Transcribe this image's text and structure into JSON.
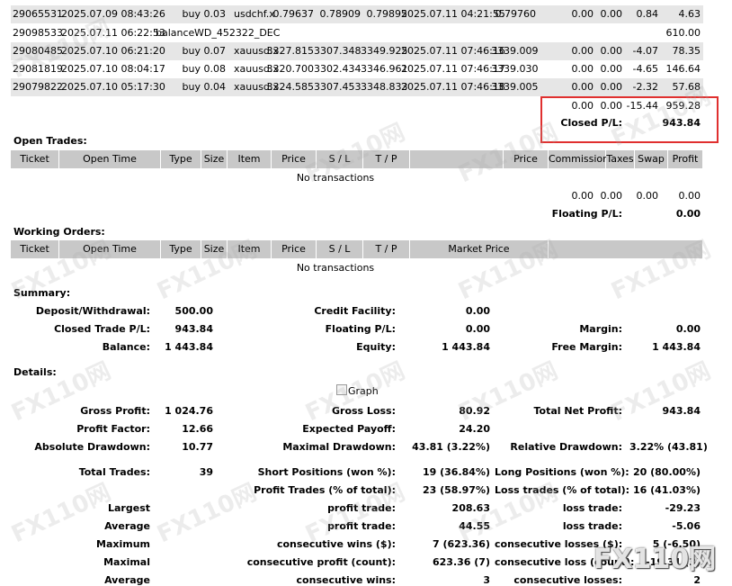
{
  "closed_trades": [
    {
      "ticket": "29065531",
      "open_time": "2025.07.09 08:43:26",
      "type": "buy",
      "size": "0.03",
      "item": "usdchf.x",
      "price": "0.79637",
      "sl": "0.78909",
      "tp": "0.79895",
      "close_time": "2025.07.11 04:21:55",
      "close_price": "0.79760",
      "commission": "0.00",
      "taxes": "0.00",
      "swap": "0.84",
      "profit": "4.63"
    },
    {
      "ticket": "29098533",
      "open_time": "2025.07.11 06:22:53",
      "type": "balance",
      "size": "",
      "item": "WD_452322_DEC",
      "price": "",
      "sl": "",
      "tp": "",
      "close_time": "",
      "close_price": "",
      "commission": "",
      "taxes": "",
      "swap": "",
      "profit": "610.00"
    },
    {
      "ticket": "29080485",
      "open_time": "2025.07.10 06:21:20",
      "type": "buy",
      "size": "0.07",
      "item": "xauusd.x",
      "price": "3327.815",
      "sl": "3307.348",
      "tp": "3349.925",
      "close_time": "2025.07.11 07:46:16",
      "close_price": "3339.009",
      "commission": "0.00",
      "taxes": "0.00",
      "swap": "-4.07",
      "profit": "78.35"
    },
    {
      "ticket": "29081819",
      "open_time": "2025.07.10 08:04:17",
      "type": "buy",
      "size": "0.08",
      "item": "xauusd.x",
      "price": "3320.700",
      "sl": "3302.434",
      "tp": "3346.961",
      "close_time": "2025.07.11 07:46:17",
      "close_price": "3339.030",
      "commission": "0.00",
      "taxes": "0.00",
      "swap": "-4.65",
      "profit": "146.64"
    },
    {
      "ticket": "29079822",
      "open_time": "2025.07.10 05:17:30",
      "type": "buy",
      "size": "0.04",
      "item": "xauusd.x",
      "price": "3324.585",
      "sl": "3307.453",
      "tp": "3348.833",
      "close_time": "2025.07.11 07:46:18",
      "close_price": "3339.005",
      "commission": "0.00",
      "taxes": "0.00",
      "swap": "-2.32",
      "profit": "57.68"
    }
  ],
  "closed_totals": {
    "commission": "0.00",
    "taxes": "0.00",
    "swap": "-15.44",
    "profit": "959.28",
    "pl_label": "Closed P/L:",
    "pl_value": "943.84"
  },
  "open_trades": {
    "title": "Open Trades:",
    "headers": {
      "ticket": "Ticket",
      "open_time": "Open Time",
      "type": "Type",
      "size": "Size",
      "item": "Item",
      "price": "Price",
      "sl": "S / L",
      "tp": "T / P",
      "price2": "Price",
      "commission": "Commission",
      "taxes": "Taxes",
      "swap": "Swap",
      "profit": "Profit"
    },
    "empty": "No transactions",
    "totals": {
      "commission": "0.00",
      "taxes": "0.00",
      "swap": "0.00",
      "profit": "0.00"
    },
    "pl_label": "Floating P/L:",
    "pl_value": "0.00"
  },
  "working_orders": {
    "title": "Working Orders:",
    "headers": {
      "ticket": "Ticket",
      "open_time": "Open Time",
      "type": "Type",
      "size": "Size",
      "item": "Item",
      "price": "Price",
      "sl": "S / L",
      "tp": "T / P",
      "market_price": "Market Price"
    },
    "empty": "No transactions"
  },
  "summary": {
    "title": "Summary:",
    "deposit_label": "Deposit/Withdrawal:",
    "deposit_value": "500.00",
    "credit_label": "Credit Facility:",
    "credit_value": "0.00",
    "closed_pl_label": "Closed Trade P/L:",
    "closed_pl_value": "943.84",
    "floating_label": "Floating P/L:",
    "floating_value": "0.00",
    "margin_label": "Margin:",
    "margin_value": "0.00",
    "balance_label": "Balance:",
    "balance_value": "1 443.84",
    "equity_label": "Equity:",
    "equity_value": "1 443.84",
    "free_margin_label": "Free Margin:",
    "free_margin_value": "1 443.84"
  },
  "details": {
    "title": "Details:",
    "graph_alt": "Graph",
    "gross_profit_label": "Gross Profit:",
    "gross_profit": "1 024.76",
    "gross_loss_label": "Gross Loss:",
    "gross_loss": "80.92",
    "net_profit_label": "Total Net Profit:",
    "net_profit": "943.84",
    "profit_factor_label": "Profit Factor:",
    "profit_factor": "12.66",
    "expected_payoff_label": "Expected Payoff:",
    "expected_payoff": "24.20",
    "abs_dd_label": "Absolute Drawdown:",
    "abs_dd": "10.77",
    "max_dd_label": "Maximal Drawdown:",
    "max_dd": "43.81 (3.22%)",
    "rel_dd_label": "Relative Drawdown:",
    "rel_dd": "3.22% (43.81)",
    "total_trades_label": "Total Trades:",
    "total_trades": "39",
    "short_label": "Short Positions (won %):",
    "short": "19 (36.84%)",
    "long_label": "Long Positions (won %):",
    "long": "20 (80.00%)",
    "profit_trades_label": "Profit Trades (% of total):",
    "profit_trades": "23 (58.97%)",
    "loss_trades_label": "Loss trades (% of total):",
    "loss_trades": "16 (41.03%)",
    "largest_label": "Largest",
    "largest_profit_label": "profit trade:",
    "largest_profit": "208.63",
    "largest_loss_label": "loss trade:",
    "largest_loss": "-29.23",
    "average_label": "Average",
    "average_profit_label": "profit trade:",
    "average_profit": "44.55",
    "average_loss_label": "loss trade:",
    "average_loss": "-5.06",
    "maximum_label": "Maximum",
    "max_cons_wins_label": "consecutive wins ($):",
    "max_cons_wins": "7 (623.36)",
    "max_cons_losses_label": "consecutive losses ($):",
    "max_cons_losses": "5 (-6.50)",
    "maximal_label": "Maximal",
    "maximal_cons_profit_label": "consecutive profit (count):",
    "maximal_cons_profit": "623.36 (7)",
    "maximal_cons_loss_label": "consecutive loss (count):",
    "maximal_cons_loss": "-19.31 (3)",
    "average2_label": "Average",
    "avg_cons_wins_label": "consecutive wins:",
    "avg_cons_wins": "3",
    "avg_cons_losses_label": "consecutive losses:",
    "avg_cons_losses": "2"
  },
  "watermark": {
    "text": "FX110网"
  }
}
